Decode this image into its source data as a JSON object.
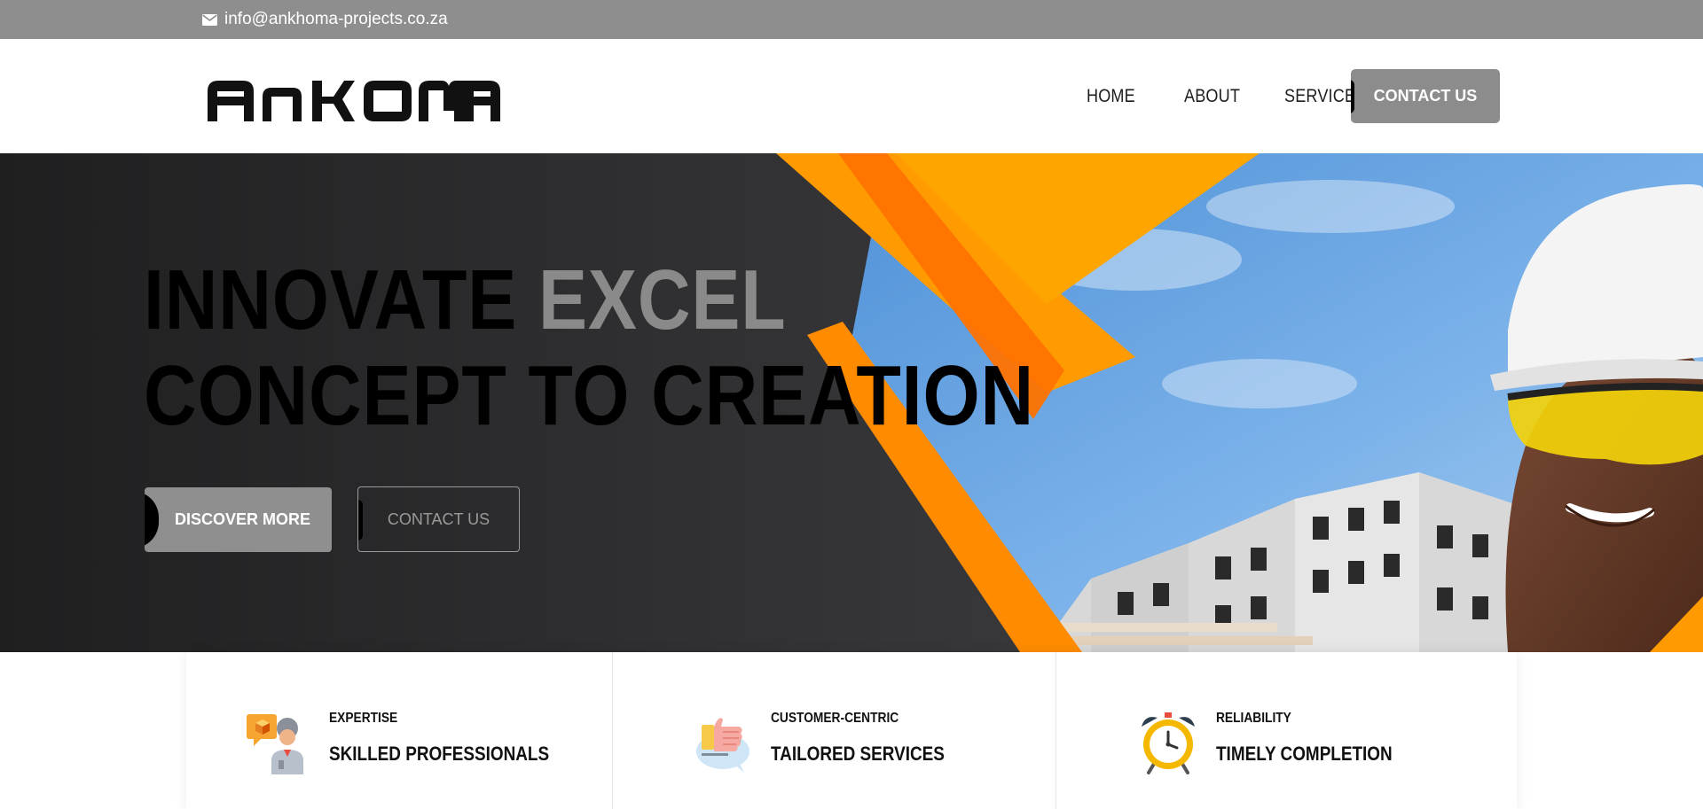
{
  "topbar": {
    "email": "info@ankhoma-projects.co.za",
    "email_icon": "envelope-icon"
  },
  "header": {
    "logo_text": "ANKOMA",
    "nav": [
      {
        "label": "HOME"
      },
      {
        "label": "ABOUT"
      },
      {
        "label": "SERVICE",
        "icon": "chevron-down-icon"
      }
    ],
    "cta_label": "CONTACT US"
  },
  "hero": {
    "title_line1_dark": "INNOVATE",
    "title_line1_accent": "EXCEL",
    "title_line2": "CONCEPT TO CREATION",
    "primary_button": "DISCOVER MORE",
    "secondary_button": "CONTACT US"
  },
  "features": [
    {
      "kicker": "EXPERTISE",
      "title": "SKILLED PROFESSIONALS",
      "icon": "professionals-icon"
    },
    {
      "kicker": "CUSTOMER-CENTRIC",
      "title": "TAILORED SERVICES",
      "icon": "thumbs-up-icon"
    },
    {
      "kicker": "RELIABILITY",
      "title": "TIMELY COMPLETION",
      "icon": "alarm-clock-icon"
    }
  ],
  "colors": {
    "topbar": "#8e8e8e",
    "accent_gray": "#8c8c8c",
    "hero_dark": "#2c2c2e",
    "orange": "#ff9900",
    "orange_dark": "#ff7a00",
    "sky": "#5e9fe0"
  }
}
